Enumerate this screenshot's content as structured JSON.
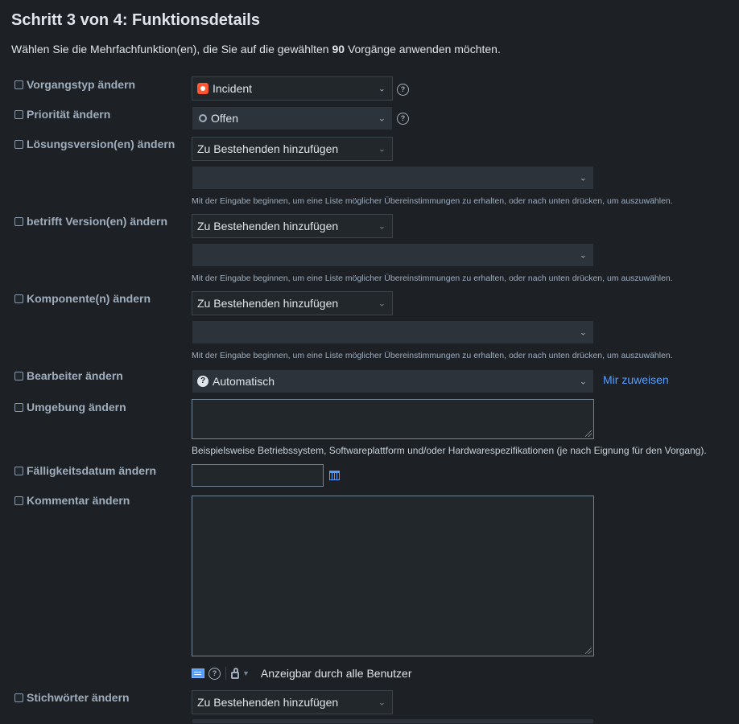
{
  "page": {
    "title": "Schritt 3 von 4: Funktionsdetails",
    "intro_before": "Wählen Sie die Mehrfachfunktion(en), die Sie auf die gewählten",
    "intro_count": "90",
    "intro_after": "Vorgänge anwenden möchten."
  },
  "fields": {
    "issue_type": {
      "label": "Vorgangstyp ändern",
      "value": "Incident"
    },
    "priority": {
      "label": "Priorität ändern",
      "value": "Offen"
    },
    "fix_version": {
      "label": "Lösungsversion(en) ändern",
      "mode": "Zu Bestehenden hinzufügen",
      "value": "",
      "hint": "Mit der Eingabe beginnen, um eine Liste möglicher Übereinstimmungen zu erhalten, oder nach unten drücken, um auszuwählen."
    },
    "affects_version": {
      "label": "betrifft Version(en) ändern",
      "mode": "Zu Bestehenden hinzufügen",
      "value": "",
      "hint": "Mit der Eingabe beginnen, um eine Liste möglicher Übereinstimmungen zu erhalten, oder nach unten drücken, um auszuwählen."
    },
    "components": {
      "label": "Komponente(n) ändern",
      "mode": "Zu Bestehenden hinzufügen",
      "value": "",
      "hint": "Mit der Eingabe beginnen, um eine Liste möglicher Übereinstimmungen zu erhalten, oder nach unten drücken, um auszuwählen."
    },
    "assignee": {
      "label": "Bearbeiter ändern",
      "value": "Automatisch",
      "assign_me": "Mir zuweisen"
    },
    "environment": {
      "label": "Umgebung ändern",
      "value": "",
      "hint": "Beispielsweise Betriebssystem, Softwareplattform und/oder Hardwarespezifikationen (je nach Eignung für den Vorgang)."
    },
    "due_date": {
      "label": "Fälligkeitsdatum ändern",
      "value": ""
    },
    "comment": {
      "label": "Kommentar ändern",
      "value": "",
      "visibility": "Anzeigbar durch alle Benutzer"
    },
    "labels": {
      "label": "Stichwörter ändern",
      "mode": "Zu Bestehenden hinzufügen"
    }
  },
  "icons": {
    "issue_type": "incident-icon",
    "priority": "circle-icon",
    "assignee": "question-avatar-icon",
    "help": "help-icon",
    "calendar": "calendar-icon",
    "wiki": "wiki-markup-icon",
    "lock": "unlock-icon"
  },
  "colors": {
    "background": "#1d2125",
    "link": "#579dff",
    "incident": "#ff5630"
  }
}
